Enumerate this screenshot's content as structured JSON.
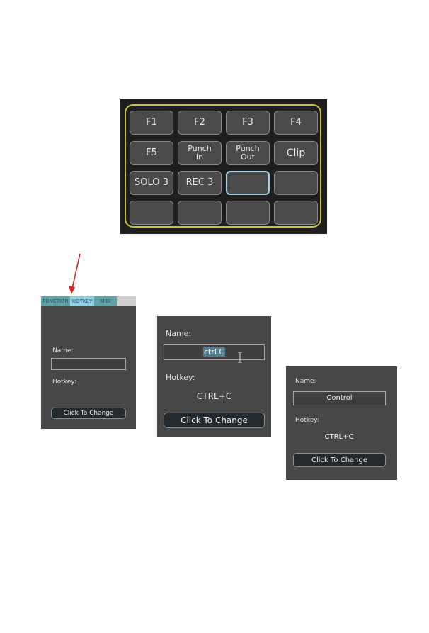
{
  "pad_grid": {
    "pads": [
      {
        "label": "F1",
        "selected": false
      },
      {
        "label": "F2",
        "selected": false
      },
      {
        "label": "F3",
        "selected": false
      },
      {
        "label": "F4",
        "selected": false
      },
      {
        "label": "F5",
        "selected": false
      },
      {
        "label": "Punch\nIn",
        "selected": false
      },
      {
        "label": "Punch\nOut",
        "selected": false
      },
      {
        "label": "Clip",
        "selected": false
      },
      {
        "label": "SOLO 3",
        "selected": false
      },
      {
        "label": "REC 3",
        "selected": false
      },
      {
        "label": "",
        "selected": true
      },
      {
        "label": "",
        "selected": false
      },
      {
        "label": "",
        "selected": false
      },
      {
        "label": "",
        "selected": false
      },
      {
        "label": "",
        "selected": false
      },
      {
        "label": "",
        "selected": false
      }
    ],
    "frame_color": "#c8c23a",
    "selected_color": "#9fd2ea"
  },
  "annotation": {
    "arrow_icon": "red-arrow-pointing-to-hotkey-tab",
    "arrow_color": "#e02020"
  },
  "panel_tabs": {
    "tabs": [
      {
        "label": "FUNCTION",
        "active": false
      },
      {
        "label": "HOTKEY",
        "active": true
      },
      {
        "label": "MIDI",
        "active": false
      }
    ]
  },
  "panel_empty": {
    "name_label": "Name:",
    "name_value": "",
    "hotkey_label": "Hotkey:",
    "hotkey_value": "",
    "button_label": "Click To Change"
  },
  "panel_editing": {
    "name_label": "Name:",
    "name_value": "ctrl C",
    "hotkey_label": "Hotkey:",
    "hotkey_value": "CTRL+C",
    "button_label": "Click To Change"
  },
  "panel_done": {
    "name_label": "Name:",
    "name_value": "Control",
    "hotkey_label": "Hotkey:",
    "hotkey_value": "CTRL+C",
    "button_label": "Click To Change"
  }
}
